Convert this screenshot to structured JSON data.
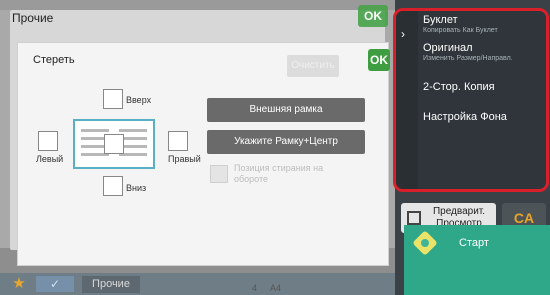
{
  "background": {
    "taskbar_tab": "Прочие",
    "star_icon": "star-icon",
    "check_icon": "check-icon",
    "paper_values": [
      "4",
      "A4",
      "",
      ""
    ]
  },
  "dialog_outer": {
    "title": "Прочие",
    "ok_label": "OK"
  },
  "dialog_inner": {
    "title": "Стереть",
    "ok_label": "OK",
    "clear_label": "Очистить",
    "labels": {
      "top": "Вверх",
      "left": "Левый",
      "right": "Правый",
      "bottom": "Вниз"
    },
    "outer_frame_button": "Внешняя рамка",
    "frame_center_button": "Укажите Рамку+Центр",
    "back_position_label": "Позиция стирания на обороте"
  },
  "right_menu": {
    "items": [
      {
        "label": "Буклет",
        "sub": "Копировать Как Буклет"
      },
      {
        "label": "Оригинал",
        "sub": "Изменить Размер/Направл."
      },
      {
        "label": "2-Стор. Копия",
        "sub": ""
      },
      {
        "label": "Настройка Фона",
        "sub": ""
      }
    ]
  },
  "actions": {
    "preview_label": "Предварит. Просмотр",
    "ca_label": "CA",
    "start_label": "Старт"
  },
  "colors": {
    "accent_red": "#d81f2a",
    "ok_green": "#3e9d41",
    "start_teal": "#2fa88a",
    "ca_orange": "#e7a429"
  }
}
